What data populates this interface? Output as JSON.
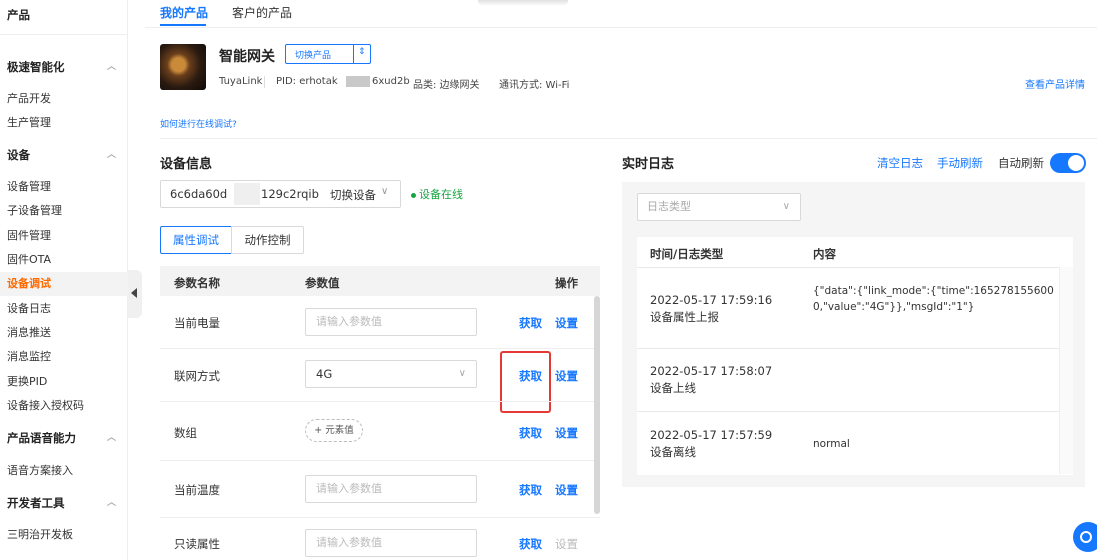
{
  "sidebar": {
    "top_label": "产品",
    "items": [
      {
        "label": "极速智能化",
        "group": true
      },
      {
        "label": "产品开发"
      },
      {
        "label": "生产管理"
      },
      {
        "label": "设备",
        "group": true
      },
      {
        "label": "设备管理"
      },
      {
        "label": "子设备管理"
      },
      {
        "label": "固件管理"
      },
      {
        "label": "固件OTA"
      },
      {
        "label": "设备调试",
        "active": true
      },
      {
        "label": "设备日志"
      },
      {
        "label": "消息推送"
      },
      {
        "label": "消息监控"
      },
      {
        "label": "更换PID"
      },
      {
        "label": "设备接入授权码"
      },
      {
        "label": "产品语音能力",
        "group": true
      },
      {
        "label": "语音方案接入"
      },
      {
        "label": "开发者工具",
        "group": true
      },
      {
        "label": "三明治开发板"
      }
    ]
  },
  "tabs": {
    "mine": "我的产品",
    "customer": "客户的产品"
  },
  "product": {
    "name": "智能网关",
    "switch_label": "切换产品",
    "platform": "TuyaLink",
    "pid_prefix": "PID: erhotak",
    "pid_suffix": "6xud2b",
    "category": "品类: 边缘网关",
    "protocol": "通讯方式: Wi-Fi",
    "detail_link": "查看产品详情"
  },
  "how_link": "如何进行在线调试?",
  "device_info": {
    "title": "设备信息",
    "id_prefix": "6c6da60d",
    "id_suffix": "129c2rqib",
    "switch_label": "切换设备",
    "status": "设备在线"
  },
  "subtabs": {
    "prop": "属性调试",
    "action": "动作控制"
  },
  "table": {
    "headers": {
      "name": "参数名称",
      "value": "参数值",
      "ops": "操作"
    },
    "get": "获取",
    "set": "设置",
    "placeholder": "请输入参数值",
    "rows": [
      {
        "name": "当前电量"
      },
      {
        "name": "联网方式",
        "value": "4G"
      },
      {
        "name": "数组",
        "add": "+ 元素值"
      },
      {
        "name": "当前温度"
      },
      {
        "name": "只读属性"
      }
    ]
  },
  "log": {
    "title": "实时日志",
    "clear": "清空日志",
    "refresh": "手动刷新",
    "auto": "自动刷新",
    "auto_enabled": true,
    "type_placeholder": "日志类型",
    "headers": {
      "time": "时间/日志类型",
      "content": "内容"
    },
    "rows": [
      {
        "time": "2022-05-17 17:59:16",
        "type": "设备属性上报",
        "content": "{\"data\":{\"link_mode\":{\"time\":1652781556000,\"value\":\"4G\"}},\"msgId\":\"1\"}"
      },
      {
        "time": "2022-05-17 17:58:07",
        "type": "设备上线",
        "content": ""
      },
      {
        "time": "2022-05-17 17:57:59",
        "type": "设备离线",
        "content": "normal"
      }
    ]
  },
  "colors": {
    "accent": "#1677ff",
    "active": "#ff6a00",
    "online": "#19a442",
    "highlight": "#e53935"
  }
}
